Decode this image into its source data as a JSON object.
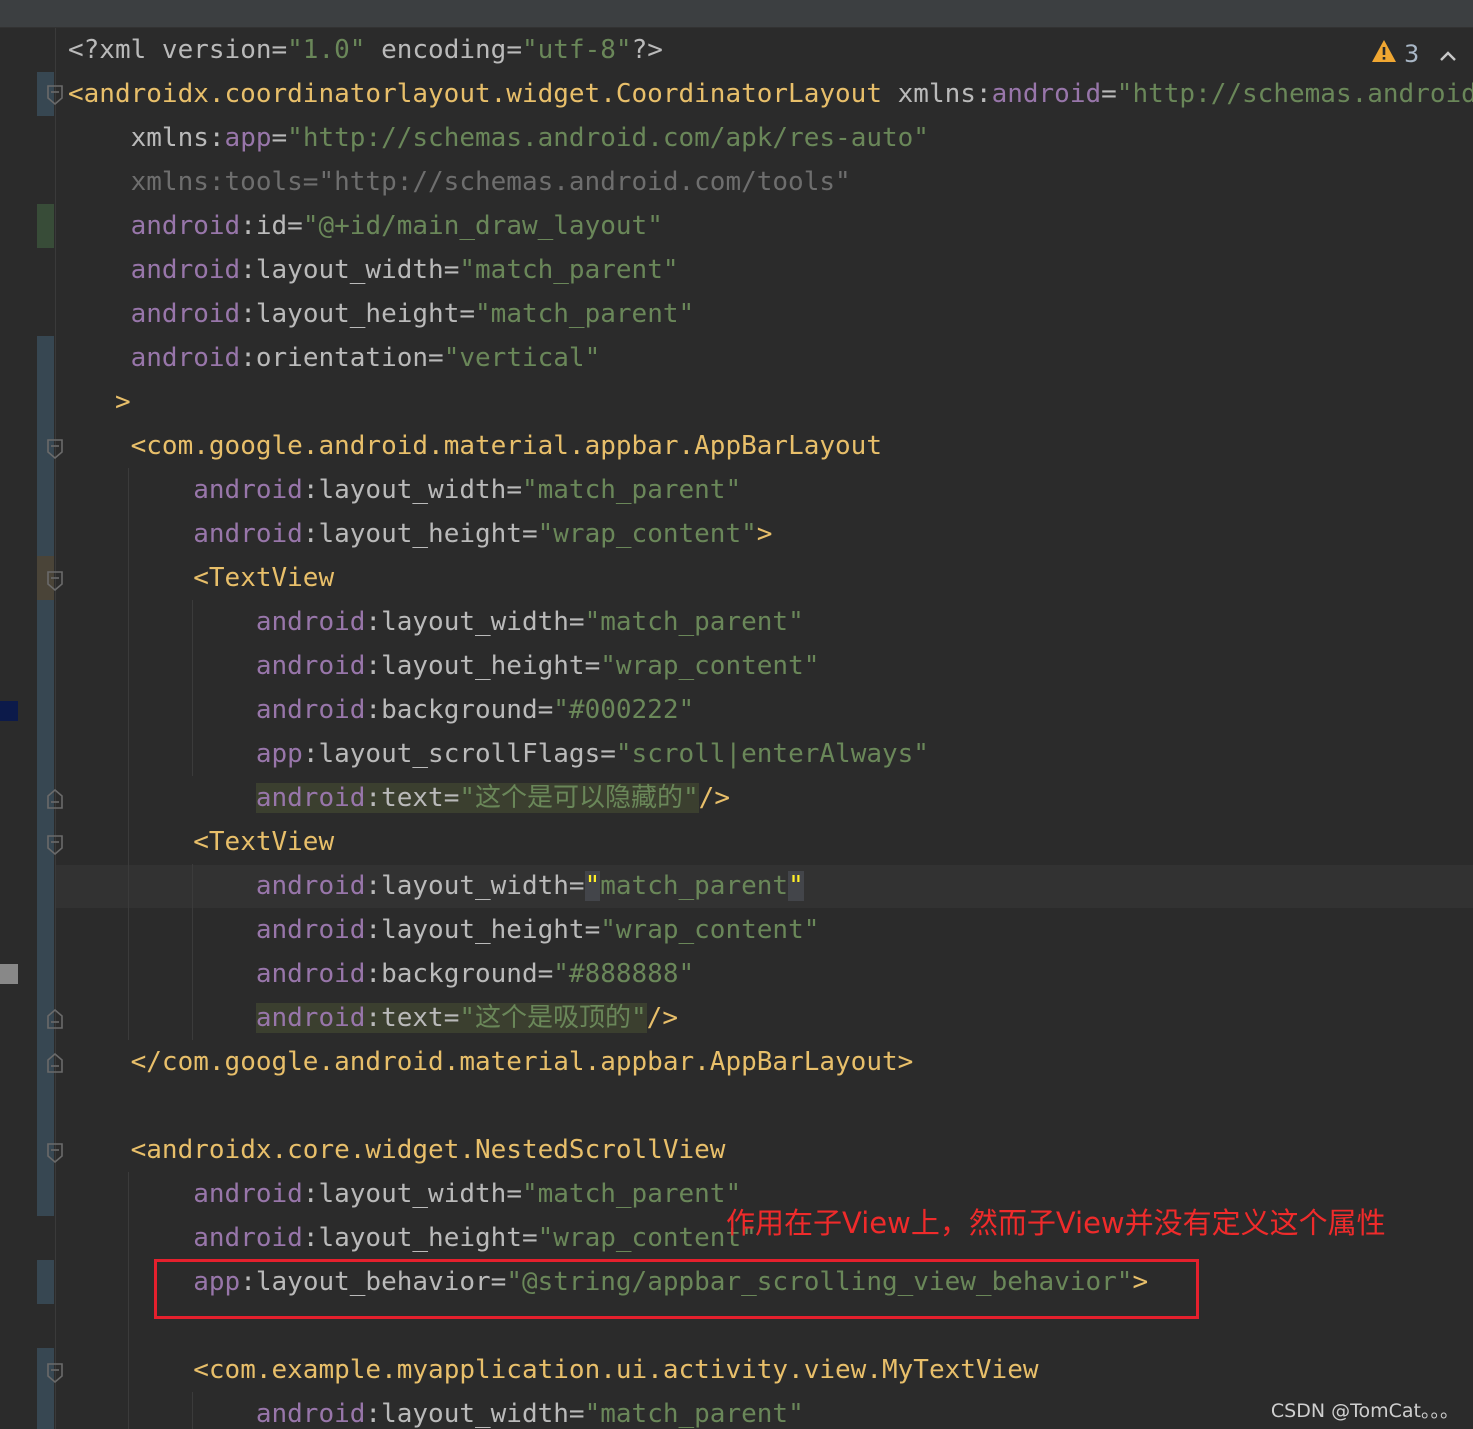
{
  "inspection": {
    "icon": "warning-icon",
    "count": "3",
    "collapse_icon": "chevron-up-icon"
  },
  "code": [
    {
      "tokens": [
        {
          "t": "<?xml ",
          "c": "attr"
        },
        {
          "t": "version",
          "c": "attr"
        },
        {
          "t": "=",
          "c": "attr"
        },
        {
          "t": "\"1.0\"",
          "c": "val"
        },
        {
          "t": " encoding",
          "c": "attr"
        },
        {
          "t": "=",
          "c": "attr"
        },
        {
          "t": "\"utf-8\"",
          "c": "val"
        },
        {
          "t": "?>",
          "c": "attr"
        }
      ]
    },
    {
      "tokens": [
        {
          "t": "<androidx.coordinatorlayout.widget.CoordinatorLayout",
          "c": "tag"
        },
        {
          "t": " xmlns:",
          "c": "attr"
        },
        {
          "t": "android",
          "c": "ns"
        },
        {
          "t": "=",
          "c": "attr"
        },
        {
          "t": "\"http://schemas.android.com/apk/res/android\"",
          "c": "val"
        }
      ]
    },
    {
      "tokens": [
        {
          "t": "    xmlns:",
          "c": "attr"
        },
        {
          "t": "app",
          "c": "ns"
        },
        {
          "t": "=",
          "c": "attr"
        },
        {
          "t": "\"http://schemas.android.com/apk/res-auto\"",
          "c": "val"
        }
      ]
    },
    {
      "tokens": [
        {
          "t": "    xmlns:tools=\"http://schemas.android.com/tools\"",
          "c": "dim"
        }
      ]
    },
    {
      "tokens": [
        {
          "t": "    ",
          "c": "attr"
        },
        {
          "t": "android",
          "c": "ns"
        },
        {
          "t": ":id",
          "c": "attr"
        },
        {
          "t": "=",
          "c": "attr"
        },
        {
          "t": "\"@+id/main_draw_layout\"",
          "c": "val"
        }
      ]
    },
    {
      "tokens": [
        {
          "t": "    ",
          "c": "attr"
        },
        {
          "t": "android",
          "c": "ns"
        },
        {
          "t": ":layout_width",
          "c": "attr"
        },
        {
          "t": "=",
          "c": "attr"
        },
        {
          "t": "\"match_parent\"",
          "c": "val"
        }
      ]
    },
    {
      "tokens": [
        {
          "t": "    ",
          "c": "attr"
        },
        {
          "t": "android",
          "c": "ns"
        },
        {
          "t": ":layout_height",
          "c": "attr"
        },
        {
          "t": "=",
          "c": "attr"
        },
        {
          "t": "\"match_parent\"",
          "c": "val"
        }
      ]
    },
    {
      "tokens": [
        {
          "t": "    ",
          "c": "attr"
        },
        {
          "t": "android",
          "c": "ns"
        },
        {
          "t": ":orientation",
          "c": "attr"
        },
        {
          "t": "=",
          "c": "attr"
        },
        {
          "t": "\"vertical\"",
          "c": "val"
        }
      ]
    },
    {
      "tokens": [
        {
          "t": "   >",
          "c": "tag"
        }
      ]
    },
    {
      "tokens": [
        {
          "t": "    ",
          "c": "attr"
        },
        {
          "t": "<com.google.android.material.appbar.AppBarLayout",
          "c": "tag"
        }
      ]
    },
    {
      "tokens": [
        {
          "t": "        ",
          "c": "attr"
        },
        {
          "t": "android",
          "c": "ns"
        },
        {
          "t": ":layout_width",
          "c": "attr"
        },
        {
          "t": "=",
          "c": "attr"
        },
        {
          "t": "\"match_parent\"",
          "c": "val"
        }
      ]
    },
    {
      "tokens": [
        {
          "t": "        ",
          "c": "attr"
        },
        {
          "t": "android",
          "c": "ns"
        },
        {
          "t": ":layout_height",
          "c": "attr"
        },
        {
          "t": "=",
          "c": "attr"
        },
        {
          "t": "\"wrap_content\"",
          "c": "val"
        },
        {
          "t": ">",
          "c": "tag"
        }
      ]
    },
    {
      "tokens": [
        {
          "t": "        ",
          "c": "attr"
        },
        {
          "t": "<TextView",
          "c": "tag"
        }
      ]
    },
    {
      "tokens": [
        {
          "t": "            ",
          "c": "attr"
        },
        {
          "t": "android",
          "c": "ns"
        },
        {
          "t": ":layout_width",
          "c": "attr"
        },
        {
          "t": "=",
          "c": "attr"
        },
        {
          "t": "\"match_parent\"",
          "c": "val"
        }
      ]
    },
    {
      "tokens": [
        {
          "t": "            ",
          "c": "attr"
        },
        {
          "t": "android",
          "c": "ns"
        },
        {
          "t": ":layout_height",
          "c": "attr"
        },
        {
          "t": "=",
          "c": "attr"
        },
        {
          "t": "\"wrap_content\"",
          "c": "val"
        }
      ]
    },
    {
      "tokens": [
        {
          "t": "            ",
          "c": "attr"
        },
        {
          "t": "android",
          "c": "ns"
        },
        {
          "t": ":background",
          "c": "attr"
        },
        {
          "t": "=",
          "c": "attr"
        },
        {
          "t": "\"#000222\"",
          "c": "val"
        }
      ]
    },
    {
      "tokens": [
        {
          "t": "            ",
          "c": "attr"
        },
        {
          "t": "app",
          "c": "ns"
        },
        {
          "t": ":layout_scrollFlags",
          "c": "attr"
        },
        {
          "t": "=",
          "c": "attr"
        },
        {
          "t": "\"scroll|enterAlways\"",
          "c": "val"
        }
      ]
    },
    {
      "tokens": [
        {
          "t": "            ",
          "c": "attr"
        },
        {
          "t": "android",
          "c": "ns hl"
        },
        {
          "t": ":text",
          "c": "attr hl"
        },
        {
          "t": "=",
          "c": "attr hl"
        },
        {
          "t": "\"这个是可以隐藏的\"",
          "c": "val hl"
        },
        {
          "t": "/>",
          "c": "tag"
        }
      ]
    },
    {
      "tokens": [
        {
          "t": "        ",
          "c": "attr"
        },
        {
          "t": "<TextView",
          "c": "tag"
        }
      ]
    },
    {
      "tokens": [
        {
          "t": "            ",
          "c": "attr"
        },
        {
          "t": "android",
          "c": "ns"
        },
        {
          "t": ":layout_width",
          "c": "attr"
        },
        {
          "t": "=",
          "c": "attr"
        },
        {
          "t": "\"",
          "c": "val brace"
        },
        {
          "t": "match_parent",
          "c": "val"
        },
        {
          "t": "\"",
          "c": "val brace"
        }
      ]
    },
    {
      "tokens": [
        {
          "t": "            ",
          "c": "attr"
        },
        {
          "t": "android",
          "c": "ns"
        },
        {
          "t": ":layout_height",
          "c": "attr"
        },
        {
          "t": "=",
          "c": "attr"
        },
        {
          "t": "\"wrap_content\"",
          "c": "val"
        }
      ]
    },
    {
      "tokens": [
        {
          "t": "            ",
          "c": "attr"
        },
        {
          "t": "android",
          "c": "ns"
        },
        {
          "t": ":background",
          "c": "attr"
        },
        {
          "t": "=",
          "c": "attr"
        },
        {
          "t": "\"#888888\"",
          "c": "val"
        }
      ]
    },
    {
      "tokens": [
        {
          "t": "            ",
          "c": "attr"
        },
        {
          "t": "android",
          "c": "ns hl"
        },
        {
          "t": ":text",
          "c": "attr hl"
        },
        {
          "t": "=",
          "c": "attr hl"
        },
        {
          "t": "\"这个是吸顶的\"",
          "c": "val hl"
        },
        {
          "t": "/>",
          "c": "tag"
        }
      ]
    },
    {
      "tokens": [
        {
          "t": "    ",
          "c": "attr"
        },
        {
          "t": "</com.google.android.material.appbar.AppBarLayout>",
          "c": "tag"
        }
      ]
    },
    {
      "tokens": [
        {
          "t": "",
          "c": "attr"
        }
      ]
    },
    {
      "tokens": [
        {
          "t": "    ",
          "c": "attr"
        },
        {
          "t": "<androidx.core.widget.NestedScrollView",
          "c": "tag"
        }
      ]
    },
    {
      "tokens": [
        {
          "t": "        ",
          "c": "attr"
        },
        {
          "t": "android",
          "c": "ns"
        },
        {
          "t": ":layout_width",
          "c": "attr"
        },
        {
          "t": "=",
          "c": "attr"
        },
        {
          "t": "\"match_parent\"",
          "c": "val"
        }
      ]
    },
    {
      "tokens": [
        {
          "t": "        ",
          "c": "attr"
        },
        {
          "t": "android",
          "c": "ns"
        },
        {
          "t": ":layout_height",
          "c": "attr"
        },
        {
          "t": "=",
          "c": "attr"
        },
        {
          "t": "\"wrap_content\"",
          "c": "val"
        }
      ]
    },
    {
      "tokens": [
        {
          "t": "        ",
          "c": "attr"
        },
        {
          "t": "app",
          "c": "ns"
        },
        {
          "t": ":layout_behavior",
          "c": "attr"
        },
        {
          "t": "=",
          "c": "attr"
        },
        {
          "t": "\"@string/appbar_scrolling_view_behavior\"",
          "c": "val"
        },
        {
          "t": ">",
          "c": "tag"
        }
      ]
    },
    {
      "tokens": [
        {
          "t": "",
          "c": "attr"
        }
      ]
    },
    {
      "tokens": [
        {
          "t": "        ",
          "c": "attr"
        },
        {
          "t": "<com.example.myapplication.ui.activity.view.MyTextView",
          "c": "tag"
        }
      ]
    },
    {
      "tokens": [
        {
          "t": "            ",
          "c": "attr"
        },
        {
          "t": "android",
          "c": "ns"
        },
        {
          "t": ":layout_width",
          "c": "attr"
        },
        {
          "t": "=",
          "c": "attr"
        },
        {
          "t": "\"match_parent\"",
          "c": "val"
        }
      ]
    }
  ],
  "annotation": {
    "text": "作用在子View上，然而子View并没有定义这个属性"
  },
  "watermark": "CSDN @TomCat。。。"
}
